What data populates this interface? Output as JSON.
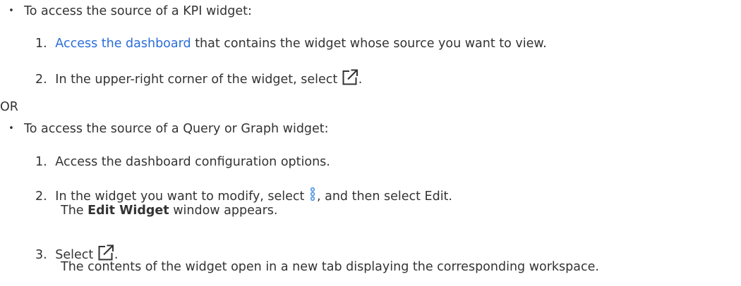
{
  "section_kpi": {
    "bullet": "•",
    "intro": "To access the source of a KPI widget:",
    "steps": [
      {
        "num": "1.",
        "link": "Access the dashboard",
        "rest": " that contains the widget whose source you want to view."
      },
      {
        "num": "2.",
        "text_before": "In the upper-right corner of the widget, select ",
        "icon": "external-link-icon",
        "text_after": "."
      }
    ]
  },
  "or_label": "OR",
  "section_query": {
    "bullet": "•",
    "intro": "To access the source of a Query or Graph widget:",
    "steps": [
      {
        "num": "1.",
        "text": "Access the dashboard configuration options."
      },
      {
        "num": "2.",
        "text_before": "In the widget you want to modify, select ",
        "icon": "kebab-menu-icon",
        "text_after": ", and then select Edit.",
        "result_bold": "Edit Widget",
        "result_rest": " window appears.",
        "result_prefix": "The "
      },
      {
        "num": "3.",
        "text_before": "Select ",
        "icon": "external-link-icon",
        "text_after": ".",
        "result": "The contents of the widget open in a new tab displaying the corresponding workspace."
      }
    ]
  },
  "colors": {
    "text": "#333333",
    "link": "#2a6dd9",
    "kebab_icon": "#5b9be6"
  }
}
